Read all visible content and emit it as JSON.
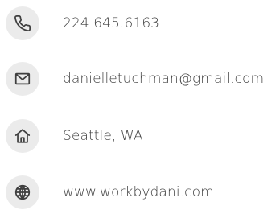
{
  "contacts": {
    "phone": {
      "icon": "phone-icon",
      "text": "224.645.6163"
    },
    "email": {
      "icon": "envelope-icon",
      "text": "danielletuchman@gmail.com"
    },
    "location": {
      "icon": "home-icon",
      "text": "Seattle, WA"
    },
    "website": {
      "icon": "globe-icon",
      "text": "www.workbydani.com"
    }
  },
  "colors": {
    "icon_background": "#ebebeb",
    "text": "#3f3f3f"
  }
}
